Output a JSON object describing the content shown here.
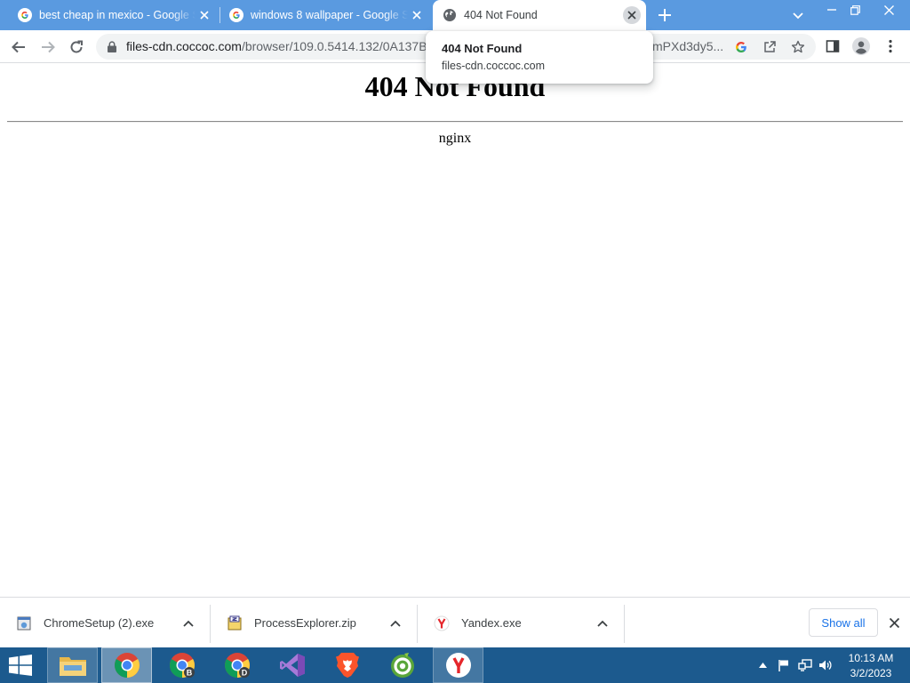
{
  "tabs": [
    {
      "title": "best cheap in mexico - Google Search",
      "favicon": "google-icon",
      "active": false
    },
    {
      "title": "windows 8 wallpaper - Google Search",
      "favicon": "google-icon",
      "active": false
    },
    {
      "title": "404 Not Found",
      "favicon": "globe-icon",
      "active": true
    }
  ],
  "toolbar": {
    "url_host": "files-cdn.coccoc.com",
    "url_path": "/browser/109.0.5414.132/0A137B3",
    "url_tail": "mPXd3dy5..."
  },
  "hover_card": {
    "title": "404 Not Found",
    "domain": "files-cdn.coccoc.com"
  },
  "page": {
    "heading": "404 Not Found",
    "server": "nginx"
  },
  "downloads": {
    "items": [
      {
        "name": "ChromeSetup (2).exe",
        "icon": "installer-icon"
      },
      {
        "name": "ProcessExplorer.zip",
        "icon": "zip-archive-icon"
      },
      {
        "name": "Yandex.exe",
        "icon": "yandex-icon"
      }
    ],
    "show_all_label": "Show all"
  },
  "taskbar": {
    "apps": [
      "start-button",
      "file-explorer",
      "chrome",
      "chrome-beta",
      "chrome-dev",
      "visual-studio",
      "brave",
      "coccoc",
      "yandex"
    ],
    "time": "10:13 AM",
    "date": "3/2/2023"
  },
  "colors": {
    "tabstrip": "#5a9ae0",
    "taskbar": "#1c5a8e",
    "link_blue": "#1a73e8"
  }
}
